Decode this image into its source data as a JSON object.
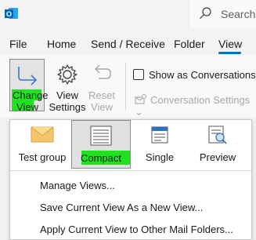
{
  "search": {
    "placeholder": "Search"
  },
  "tabs": [
    {
      "label": "File"
    },
    {
      "label": "Home"
    },
    {
      "label": "Send / Receive"
    },
    {
      "label": "Folder"
    },
    {
      "label": "View",
      "active": true
    }
  ],
  "ribbon": {
    "change_view": {
      "line1": "Change",
      "line2": "View",
      "arrow": "⌄"
    },
    "view_settings": {
      "line1": "View",
      "line2": "Settings"
    },
    "reset_view": {
      "line1": "Reset",
      "line2": "View"
    },
    "show_as_conversations": {
      "label": "Show as Conversations",
      "checked": false
    },
    "conversation_settings": {
      "label": "Conversation Settings",
      "arrow": "⌄"
    }
  },
  "views": [
    {
      "label": "Test group",
      "icon": "envelope-icon"
    },
    {
      "label": "Compact",
      "icon": "compact-list-icon",
      "selected": true
    },
    {
      "label": "Single",
      "icon": "single-list-icon"
    },
    {
      "label": "Preview",
      "icon": "preview-icon"
    }
  ],
  "menu": {
    "manage_views": "Manage Views...",
    "save_view": "Save Current View As a New View...",
    "apply_view": "Apply Current View to Other Mail Folders..."
  },
  "colors": {
    "accent": "#0f6cbd",
    "highlight": "#1ee31e"
  }
}
